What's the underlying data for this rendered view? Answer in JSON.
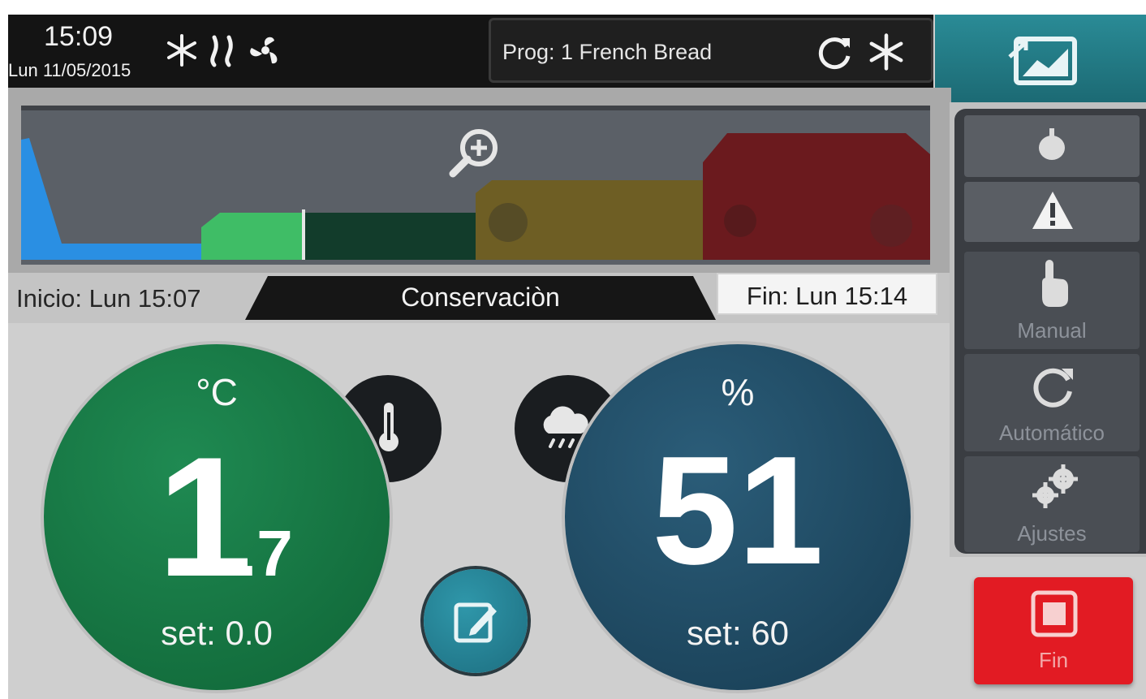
{
  "status": {
    "time": "15:09",
    "date": "Lun 11/05/2015"
  },
  "status_icons": [
    "snowflake-icon",
    "steam-icon",
    "fan-icon"
  ],
  "program": {
    "text": "Prog: 1  French Bread",
    "icons": [
      "cycle-icon",
      "snowflake-icon"
    ]
  },
  "chart": {
    "zoom_icon": "zoom-in-icon",
    "phases": [
      {
        "name": "cooling",
        "color": "#2a8fe3"
      },
      {
        "name": "stage-2",
        "color": "#3fbd66"
      },
      {
        "name": "conservation",
        "color": "#123c2b"
      },
      {
        "name": "stage-4",
        "color": "#6e5e24"
      },
      {
        "name": "stage-5",
        "color": "#6b1a1e"
      }
    ]
  },
  "phase": {
    "start": "Inicio: Lun 15:07",
    "current": "Conservaciòn",
    "end": "Fin: Lun 15:14"
  },
  "temperature": {
    "unit": "°C",
    "value_int": "1",
    "value_dec": ".7",
    "set": "set: 0.0",
    "color": "#167a45"
  },
  "humidity": {
    "unit": "%",
    "value": "51",
    "set": "set: 60",
    "color": "#1f4a63"
  },
  "sidebar": {
    "manual_label": "Manual",
    "auto_label": "Automático",
    "settings_label": "Ajustes"
  },
  "fin_button": {
    "label": "Fin",
    "color": "#e21b23"
  }
}
